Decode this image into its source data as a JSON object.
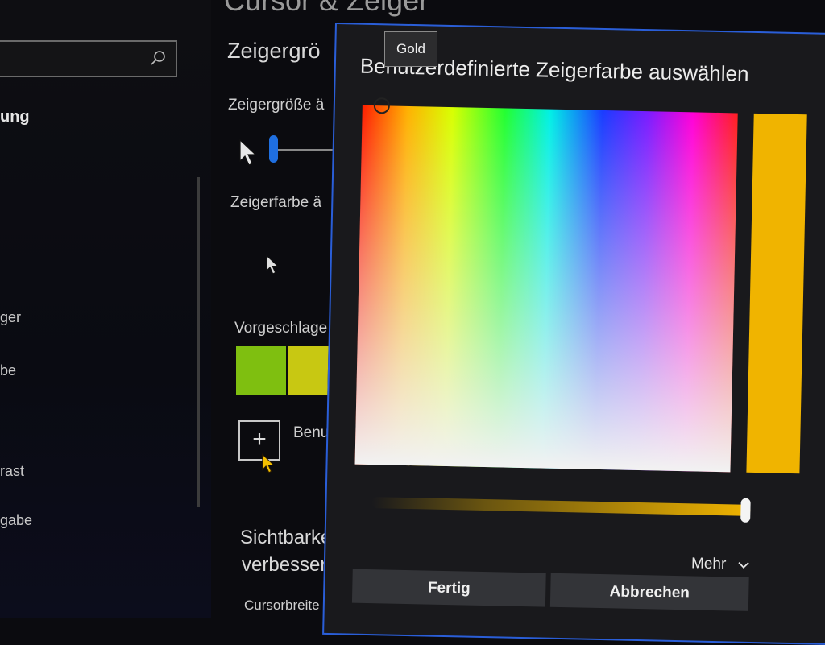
{
  "nav": {
    "items": [
      {
        "label": "ung",
        "bold": true
      },
      {
        "label": "ger"
      },
      {
        "label": "be"
      },
      {
        "label": "rast"
      },
      {
        "label": "gabe"
      }
    ]
  },
  "page": {
    "title": "Cursor & Zeiger",
    "section_pointer_size": "Zeigergrö",
    "pointer_size_label": "Zeigergröße ä",
    "pointer_color_label": "Zeigerfarbe ä",
    "suggested_label": "Vorgeschlage",
    "custom_label": "Benut",
    "visibility_heading_line1": "Sichtbarke",
    "visibility_heading_line2": "verbesserr",
    "cursor_width_label": "Cursorbreite",
    "swatches": [
      "#7fbf10",
      "#c8c812"
    ]
  },
  "dialog": {
    "title": "Benutzerdefinierte Zeigerfarbe auswählen",
    "selected_color": "#f0b400",
    "value_level": 1.0,
    "more_label": "Mehr",
    "done_label": "Fertig",
    "cancel_label": "Abbrechen"
  },
  "tooltip": {
    "label": "Gold"
  },
  "icons": [
    "search-icon",
    "pointer-arrow-icon",
    "plus-icon",
    "chevron-down-icon",
    "mouse-cursor-icon"
  ]
}
